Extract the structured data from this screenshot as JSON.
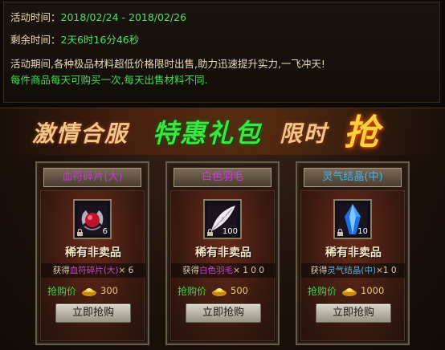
{
  "info": {
    "time_label": "活动时间：",
    "time_value": "2018/02/24 - 2018/02/26",
    "remain_label": "剩余时间：",
    "remain_value": "2天6时16分46秒",
    "desc_line1": "活动期间,各种极品材料超低价格限时出售,助力迅速提升实力,一飞冲天!",
    "desc_line2": "每件商品每天可购买一次,每天出售材料不同."
  },
  "banner": {
    "part1": "激情合服",
    "part2": "特惠礼包",
    "part3": "限时",
    "part4": "抢"
  },
  "cards": [
    {
      "title": "血符碎片(大)",
      "title_color": "#c43ad0",
      "item_icon": "red-gem-icon",
      "quantity": "6",
      "rarity": "稀有非卖品",
      "obtain_prefix": "获得",
      "obtain_item": "血符碎片(大)",
      "obtain_item_color": "#c24bd6",
      "obtain_suffix": "× 6",
      "price_label": "抢购价",
      "price": "300",
      "buy_label": "立即抢购"
    },
    {
      "title": "白色羽毛",
      "title_color": "#d23ae0",
      "item_icon": "white-feather-icon",
      "quantity": "100",
      "rarity": "稀有非卖品",
      "obtain_prefix": "获得",
      "obtain_item": "白色羽毛",
      "obtain_item_color": "#c24bd6",
      "obtain_suffix": "× 1 0 0",
      "price_label": "抢购价",
      "price": "500",
      "buy_label": "立即抢购"
    },
    {
      "title": "灵气结晶(中)",
      "title_color": "#3ab8f0",
      "item_icon": "blue-crystal-icon",
      "quantity": "10",
      "rarity": "稀有非卖品",
      "obtain_prefix": "获得",
      "obtain_item": "灵气结晶(中)",
      "obtain_item_color": "#4fb2e8",
      "obtain_suffix": "×1 0",
      "price_label": "抢购价",
      "price": "1000",
      "buy_label": "立即抢购"
    }
  ]
}
